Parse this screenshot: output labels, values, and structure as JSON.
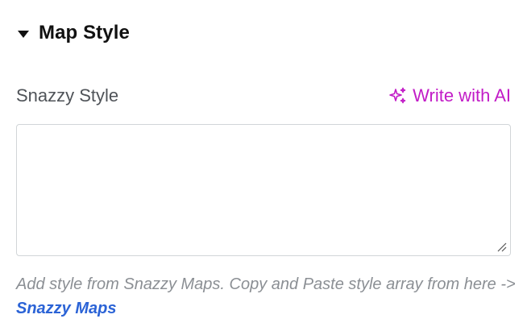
{
  "section": {
    "title": "Map Style",
    "caret_icon": "caret-down-icon"
  },
  "field": {
    "label": "Snazzy Style",
    "value": "",
    "placeholder": ""
  },
  "ai_action": {
    "label": "Write with AI",
    "icon": "sparkles-icon",
    "color": "#c21cc7"
  },
  "help": {
    "text": "Add style from Snazzy Maps. Copy and Paste style array from here -> ",
    "link_label": "Snazzy Maps",
    "link_color": "#2b63d6"
  }
}
